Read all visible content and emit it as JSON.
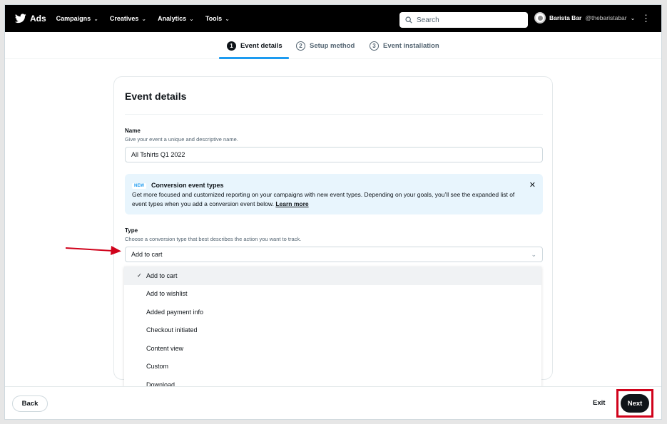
{
  "nav": {
    "brand": "Ads",
    "menus": [
      {
        "label": "Campaigns"
      },
      {
        "label": "Creatives"
      },
      {
        "label": "Analytics"
      },
      {
        "label": "Tools"
      }
    ],
    "search_placeholder": "Search",
    "account_name": "Barista Bar",
    "account_handle": "@thebaristabar"
  },
  "steps": [
    {
      "num": "1",
      "label": "Event details",
      "active": true
    },
    {
      "num": "2",
      "label": "Setup method",
      "active": false
    },
    {
      "num": "3",
      "label": "Event installation",
      "active": false
    }
  ],
  "card": {
    "title": "Event details",
    "name_label": "Name",
    "name_helper": "Give your event a unique and descriptive name.",
    "name_value": "All Tshirts Q1 2022",
    "notice": {
      "badge": "NEW",
      "title": "Conversion event types",
      "body": "Get more focused and customized reporting on your campaigns with new event types. Depending on your goals, you’ll see the expanded list of event types when you add a conversion event below.",
      "link": "Learn more"
    },
    "type_label": "Type",
    "type_helper": "Choose a conversion type that best describes the action you want to track.",
    "type_value": "Add to cart",
    "type_options": [
      {
        "label": "Add to cart",
        "selected": true
      },
      {
        "label": "Add to wishlist"
      },
      {
        "label": "Added payment info"
      },
      {
        "label": "Checkout initiated"
      },
      {
        "label": "Content view"
      },
      {
        "label": "Custom"
      },
      {
        "label": "Download"
      }
    ]
  },
  "footer": {
    "back": "Back",
    "exit": "Exit",
    "next": "Next"
  },
  "colors": {
    "accent": "#1d9bf0",
    "annotation": "#d0021b",
    "nav_bg": "#000000"
  }
}
